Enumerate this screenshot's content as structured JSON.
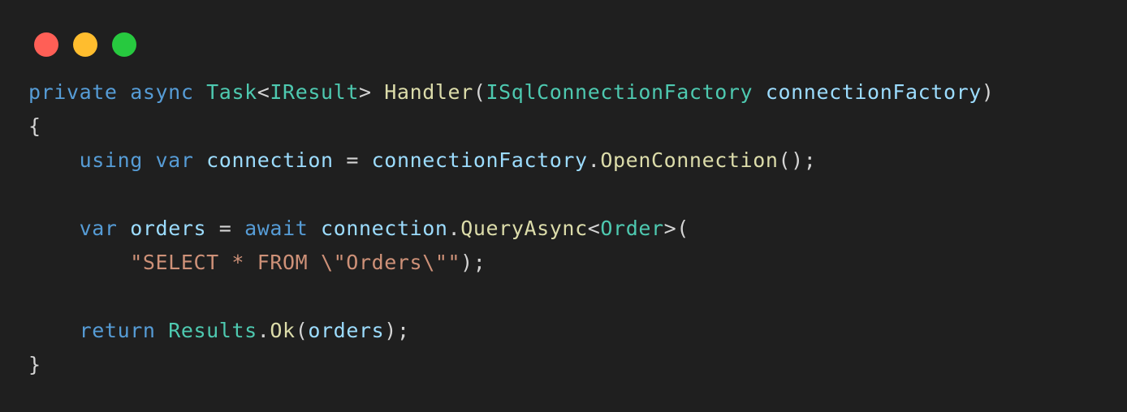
{
  "window": {
    "controls": {
      "close_color": "#ff5f56",
      "minimize_color": "#ffbd2e",
      "maximize_color": "#27c93f"
    }
  },
  "colors": {
    "background": "#1f1f1f",
    "keyword": "#569cd6",
    "type": "#4ec9b0",
    "function": "#dcdcaa",
    "identifier": "#9cdcfe",
    "string": "#ce9178",
    "punctuation": "#d4d4d4"
  },
  "code": {
    "lines": [
      [
        {
          "t": "private",
          "k": "kw"
        },
        {
          "t": " ",
          "k": "pn"
        },
        {
          "t": "async",
          "k": "kw"
        },
        {
          "t": " ",
          "k": "pn"
        },
        {
          "t": "Task",
          "k": "ty"
        },
        {
          "t": "<",
          "k": "pn"
        },
        {
          "t": "IResult",
          "k": "ty"
        },
        {
          "t": "> ",
          "k": "pn"
        },
        {
          "t": "Handler",
          "k": "fn"
        },
        {
          "t": "(",
          "k": "pn"
        },
        {
          "t": "ISqlConnectionFactory",
          "k": "ty"
        },
        {
          "t": " ",
          "k": "pn"
        },
        {
          "t": "connectionFactory",
          "k": "id"
        },
        {
          "t": ")",
          "k": "pn"
        }
      ],
      [
        {
          "t": "{",
          "k": "pn"
        }
      ],
      [
        {
          "t": "    ",
          "k": "pn"
        },
        {
          "t": "using",
          "k": "kw"
        },
        {
          "t": " ",
          "k": "pn"
        },
        {
          "t": "var",
          "k": "kw"
        },
        {
          "t": " ",
          "k": "pn"
        },
        {
          "t": "connection",
          "k": "id"
        },
        {
          "t": " = ",
          "k": "pn"
        },
        {
          "t": "connectionFactory",
          "k": "id"
        },
        {
          "t": ".",
          "k": "pn"
        },
        {
          "t": "OpenConnection",
          "k": "fn"
        },
        {
          "t": "();",
          "k": "pn"
        }
      ],
      [],
      [
        {
          "t": "    ",
          "k": "pn"
        },
        {
          "t": "var",
          "k": "kw"
        },
        {
          "t": " ",
          "k": "pn"
        },
        {
          "t": "orders",
          "k": "id"
        },
        {
          "t": " = ",
          "k": "pn"
        },
        {
          "t": "await",
          "k": "kw"
        },
        {
          "t": " ",
          "k": "pn"
        },
        {
          "t": "connection",
          "k": "id"
        },
        {
          "t": ".",
          "k": "pn"
        },
        {
          "t": "QueryAsync",
          "k": "fn"
        },
        {
          "t": "<",
          "k": "pn"
        },
        {
          "t": "Order",
          "k": "ty"
        },
        {
          "t": ">(",
          "k": "pn"
        }
      ],
      [
        {
          "t": "        ",
          "k": "pn"
        },
        {
          "t": "\"SELECT * FROM \\\"Orders\\\"\"",
          "k": "st"
        },
        {
          "t": ");",
          "k": "pn"
        }
      ],
      [],
      [
        {
          "t": "    ",
          "k": "pn"
        },
        {
          "t": "return",
          "k": "kw"
        },
        {
          "t": " ",
          "k": "pn"
        },
        {
          "t": "Results",
          "k": "ty"
        },
        {
          "t": ".",
          "k": "pn"
        },
        {
          "t": "Ok",
          "k": "fn"
        },
        {
          "t": "(",
          "k": "pn"
        },
        {
          "t": "orders",
          "k": "id"
        },
        {
          "t": ");",
          "k": "pn"
        }
      ],
      [
        {
          "t": "}",
          "k": "pn"
        }
      ]
    ]
  }
}
